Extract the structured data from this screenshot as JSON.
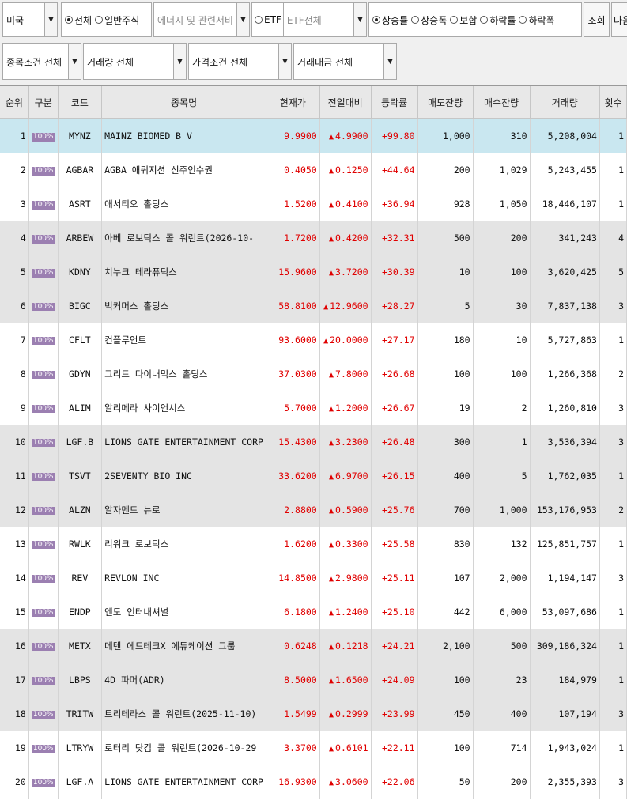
{
  "filters": {
    "market": "미국",
    "stock_type_options": [
      "전체",
      "일반주식"
    ],
    "stock_type_selected": "전체",
    "sector_placeholder": "에너지 및 관련서비",
    "etf_label": "ETF",
    "etf_value": "ETF전체",
    "sort_options": [
      "상승률",
      "상승폭",
      "보합",
      "하락률",
      "하락폭"
    ],
    "sort_selected": "상승률",
    "query_button": "조회",
    "next_button": "다음",
    "condition": "종목조건 전체",
    "volume": "거래량 전체",
    "price": "가격조건 전체",
    "amount": "거래대금 전체"
  },
  "columns": [
    "순위",
    "구분",
    "코드",
    "종목명",
    "현재가",
    "전일대비",
    "등락률",
    "매도잔량",
    "매수잔량",
    "거래량",
    "횟수"
  ],
  "up_symbol": "▲",
  "rows": [
    {
      "rank": "1",
      "badge": "100%",
      "code": "MYNZ",
      "name": "MAINZ BIOMED B V",
      "price": "9.9900",
      "change": "4.9900",
      "rate": "+99.80",
      "ask": "1,000",
      "bid": "310",
      "volume": "5,208,004",
      "count": "1"
    },
    {
      "rank": "2",
      "badge": "100%",
      "code": "AGBAR",
      "name": "AGBA 애퀴지션 신주인수권",
      "price": "0.4050",
      "change": "0.1250",
      "rate": "+44.64",
      "ask": "200",
      "bid": "1,029",
      "volume": "5,243,455",
      "count": "1"
    },
    {
      "rank": "3",
      "badge": "100%",
      "code": "ASRT",
      "name": "애서티오 홀딩스",
      "price": "1.5200",
      "change": "0.4100",
      "rate": "+36.94",
      "ask": "928",
      "bid": "1,050",
      "volume": "18,446,107",
      "count": "1"
    },
    {
      "rank": "4",
      "badge": "100%",
      "code": "ARBEW",
      "name": "아베 로보틱스 콜 워런트(2026-10-",
      "price": "1.7200",
      "change": "0.4200",
      "rate": "+32.31",
      "ask": "500",
      "bid": "200",
      "volume": "341,243",
      "count": "4"
    },
    {
      "rank": "5",
      "badge": "100%",
      "code": "KDNY",
      "name": "치누크 테라퓨틱스",
      "price": "15.9600",
      "change": "3.7200",
      "rate": "+30.39",
      "ask": "10",
      "bid": "100",
      "volume": "3,620,425",
      "count": "5"
    },
    {
      "rank": "6",
      "badge": "100%",
      "code": "BIGC",
      "name": "빅커머스 홀딩스",
      "price": "58.8100",
      "change": "12.9600",
      "rate": "+28.27",
      "ask": "5",
      "bid": "30",
      "volume": "7,837,138",
      "count": "3"
    },
    {
      "rank": "7",
      "badge": "100%",
      "code": "CFLT",
      "name": "컨플루언트",
      "price": "93.6000",
      "change": "20.0000",
      "rate": "+27.17",
      "ask": "180",
      "bid": "10",
      "volume": "5,727,863",
      "count": "1"
    },
    {
      "rank": "8",
      "badge": "100%",
      "code": "GDYN",
      "name": "그리드 다이내믹스 홀딩스",
      "price": "37.0300",
      "change": "7.8000",
      "rate": "+26.68",
      "ask": "100",
      "bid": "100",
      "volume": "1,266,368",
      "count": "2"
    },
    {
      "rank": "9",
      "badge": "100%",
      "code": "ALIM",
      "name": "알리메라 사이언시스",
      "price": "5.7000",
      "change": "1.2000",
      "rate": "+26.67",
      "ask": "19",
      "bid": "2",
      "volume": "1,260,810",
      "count": "3"
    },
    {
      "rank": "10",
      "badge": "100%",
      "code": "LGF.B",
      "name": "LIONS GATE ENTERTAINMENT CORP",
      "price": "15.4300",
      "change": "3.2300",
      "rate": "+26.48",
      "ask": "300",
      "bid": "1",
      "volume": "3,536,394",
      "count": "3"
    },
    {
      "rank": "11",
      "badge": "100%",
      "code": "TSVT",
      "name": "2SEVENTY BIO INC",
      "price": "33.6200",
      "change": "6.9700",
      "rate": "+26.15",
      "ask": "400",
      "bid": "5",
      "volume": "1,762,035",
      "count": "1"
    },
    {
      "rank": "12",
      "badge": "100%",
      "code": "ALZN",
      "name": "알자멘드 뉴로",
      "price": "2.8800",
      "change": "0.5900",
      "rate": "+25.76",
      "ask": "700",
      "bid": "1,000",
      "volume": "153,176,953",
      "count": "2"
    },
    {
      "rank": "13",
      "badge": "100%",
      "code": "RWLK",
      "name": "리워크 로보틱스",
      "price": "1.6200",
      "change": "0.3300",
      "rate": "+25.58",
      "ask": "830",
      "bid": "132",
      "volume": "125,851,757",
      "count": "1"
    },
    {
      "rank": "14",
      "badge": "100%",
      "code": "REV",
      "name": "REVLON INC",
      "price": "14.8500",
      "change": "2.9800",
      "rate": "+25.11",
      "ask": "107",
      "bid": "2,000",
      "volume": "1,194,147",
      "count": "3"
    },
    {
      "rank": "15",
      "badge": "100%",
      "code": "ENDP",
      "name": "엔도 인터내셔널",
      "price": "6.1800",
      "change": "1.2400",
      "rate": "+25.10",
      "ask": "442",
      "bid": "6,000",
      "volume": "53,097,686",
      "count": "1"
    },
    {
      "rank": "16",
      "badge": "100%",
      "code": "METX",
      "name": "메텐 에드테크X 에듀케이션 그룹",
      "price": "0.6248",
      "change": "0.1218",
      "rate": "+24.21",
      "ask": "2,100",
      "bid": "500",
      "volume": "309,186,324",
      "count": "1"
    },
    {
      "rank": "17",
      "badge": "100%",
      "code": "LBPS",
      "name": "4D 파머(ADR)",
      "price": "8.5000",
      "change": "1.6500",
      "rate": "+24.09",
      "ask": "100",
      "bid": "23",
      "volume": "184,979",
      "count": "1"
    },
    {
      "rank": "18",
      "badge": "100%",
      "code": "TRITW",
      "name": "트리테라스 콜 워런트(2025-11-10)",
      "price": "1.5499",
      "change": "0.2999",
      "rate": "+23.99",
      "ask": "450",
      "bid": "400",
      "volume": "107,194",
      "count": "3"
    },
    {
      "rank": "19",
      "badge": "100%",
      "code": "LTRYW",
      "name": "로터리 닷컴 콜 워런트(2026-10-29",
      "price": "3.3700",
      "change": "0.6101",
      "rate": "+22.11",
      "ask": "100",
      "bid": "714",
      "volume": "1,943,024",
      "count": "1"
    },
    {
      "rank": "20",
      "badge": "100%",
      "code": "LGF.A",
      "name": "LIONS GATE ENTERTAINMENT CORP",
      "price": "16.9300",
      "change": "3.0600",
      "rate": "+22.06",
      "ask": "50",
      "bid": "200",
      "volume": "2,355,393",
      "count": "3"
    }
  ]
}
